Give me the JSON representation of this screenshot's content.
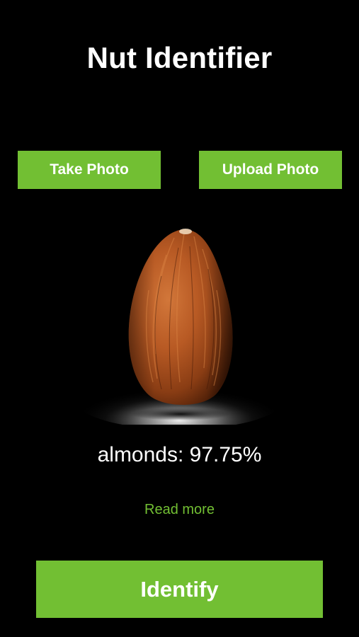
{
  "app": {
    "title": "Nut Identifier"
  },
  "actions": {
    "take_photo_label": "Take Photo",
    "upload_photo_label": "Upload Photo",
    "identify_label": "Identify"
  },
  "result": {
    "text": "almonds: 97.75%",
    "read_more_label": "Read more"
  },
  "colors": {
    "accent": "#72bf33",
    "background": "#000000",
    "text": "#ffffff"
  },
  "icons": {
    "photo": "almond-photo"
  }
}
